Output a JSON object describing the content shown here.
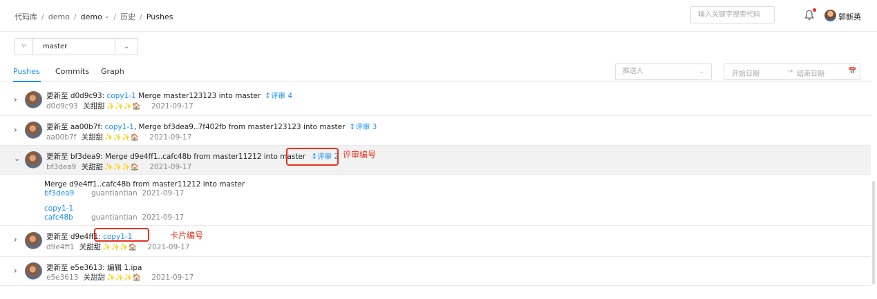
{
  "header": {
    "breadcrumb": {
      "repos": "代码库",
      "project": "demo",
      "repo": "demo",
      "history": "历史",
      "current": "Pushes"
    },
    "search_placeholder": "输入关键字搜索代码",
    "user_name": "郭新英"
  },
  "branch": {
    "icon": "branch-icon",
    "name": "master"
  },
  "tabs": {
    "pushes": "Pushes",
    "commits": "Commits",
    "graph": "Graph"
  },
  "filters": {
    "pusher_placeholder": "推送人",
    "start_date": "开始日期",
    "arrow": "→",
    "end_date": "结束日期"
  },
  "pushes": [
    {
      "title_prefix": "更新至 d0d9c93: ",
      "card": "copy1-1",
      "title_rest": " Merge master123123 into master",
      "review": "评审 4",
      "sha": "d0d9c93",
      "user": "关甜甜",
      "emojis": "✨✨✨🏠",
      "date": "2021-09-17"
    },
    {
      "title_prefix": "更新至 aa00b7f: ",
      "card": "copy1-1",
      "title_rest": ",   Merge bf3dea9..7f402fb from master123123 into master",
      "review": "评审 3",
      "sha": "aa00b7f",
      "user": "关甜甜",
      "emojis": "✨✨✨🏠",
      "date": "2021-09-17"
    },
    {
      "title_prefix": "更新至 bf3dea9: Merge d9e4ff1..cafc48b from master11212 into master",
      "review": "评审 2",
      "sha": "bf3dea9",
      "user": "关甜甜",
      "emojis": "✨✨✨🏠",
      "date": "2021-09-17",
      "commits": [
        {
          "message": "Merge d9e4ff1..cafc48b from master11212 into master",
          "sha": "bf3dea9",
          "author": "guantiantian",
          "date": "2021-09-17"
        },
        {
          "message": "copy1-1",
          "sha": "cafc48b",
          "author": "guantiantian",
          "date": "2021-09-17"
        }
      ]
    },
    {
      "title_prefix": "更新至 d9e4ff1: ",
      "card": "copy1-1",
      "sha": "d9e4ff1",
      "user": "关甜甜",
      "emojis": "✨✨✨🏠",
      "date": "2021-09-17"
    },
    {
      "title_prefix": "更新至 e5e3613: 编辑 1.ipa",
      "sha": "e5e3613",
      "user": "关甜甜",
      "emojis": "✨✨✨🏠",
      "date": "2021-09-17"
    }
  ],
  "annotations": {
    "review_number": "评审编号",
    "card_number": "卡片编号"
  },
  "colors": {
    "accent": "#1890ff",
    "annotation": "#e8321e",
    "notification": "#f5222d"
  }
}
